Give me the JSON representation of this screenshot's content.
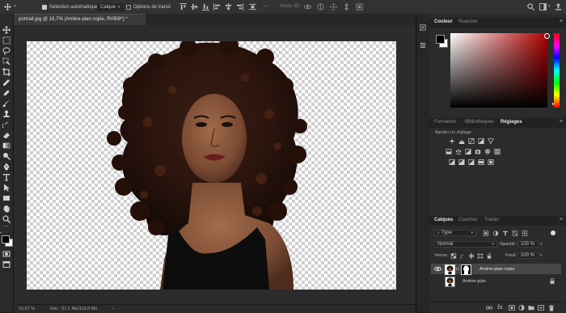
{
  "options_bar": {
    "auto_select_label": "Sélection automatique :",
    "auto_select_checked": true,
    "target_value": "Calque",
    "transform_label": "Options de transf.",
    "transform_checked": false,
    "mode_3d_label": "Mode 3D :"
  },
  "document": {
    "tab_title": "portrait.jpg @ 16,7% (Arrière-plan copie, RVB/8*) *",
    "close_glyph": "×"
  },
  "status": {
    "zoom": "16,67 %",
    "doc_info": "Doc : 57,1 Mo/118,8 Mo",
    "arrow": "›"
  },
  "color_panel": {
    "tabs": [
      "Couleur",
      "Nuancier"
    ],
    "active_tab": 0,
    "foreground": "#000000",
    "background": "#ffffff"
  },
  "adjust_panel": {
    "tabs": [
      "Formation",
      "Bibliothèques",
      "Réglages"
    ],
    "active_tab": 2,
    "add_label": "Ajouter un réglage"
  },
  "layers_panel": {
    "tabs": [
      "Calques",
      "Couches",
      "Tracés"
    ],
    "active_tab": 0,
    "filter_label": "Type",
    "blend_mode": "Normal",
    "opacity_label": "Opacité :",
    "opacity_value": "100 %",
    "lock_label": "Verrou :",
    "fill_label": "Fond :",
    "fill_value": "100 %",
    "layers": [
      {
        "name": "Arrière-plan copie",
        "selected": true,
        "visible": true,
        "has_mask": true,
        "locked": false
      },
      {
        "name": "Arrière-plan",
        "selected": false,
        "visible": false,
        "has_mask": false,
        "locked": true
      }
    ]
  },
  "colors": {
    "panel_bg": "#2b2b2b",
    "toolbar_bg": "#2a2a2a",
    "workspace_bg": "#2c2c2c",
    "selected_layer_bg": "#474747",
    "text": "#c8c8c8"
  }
}
